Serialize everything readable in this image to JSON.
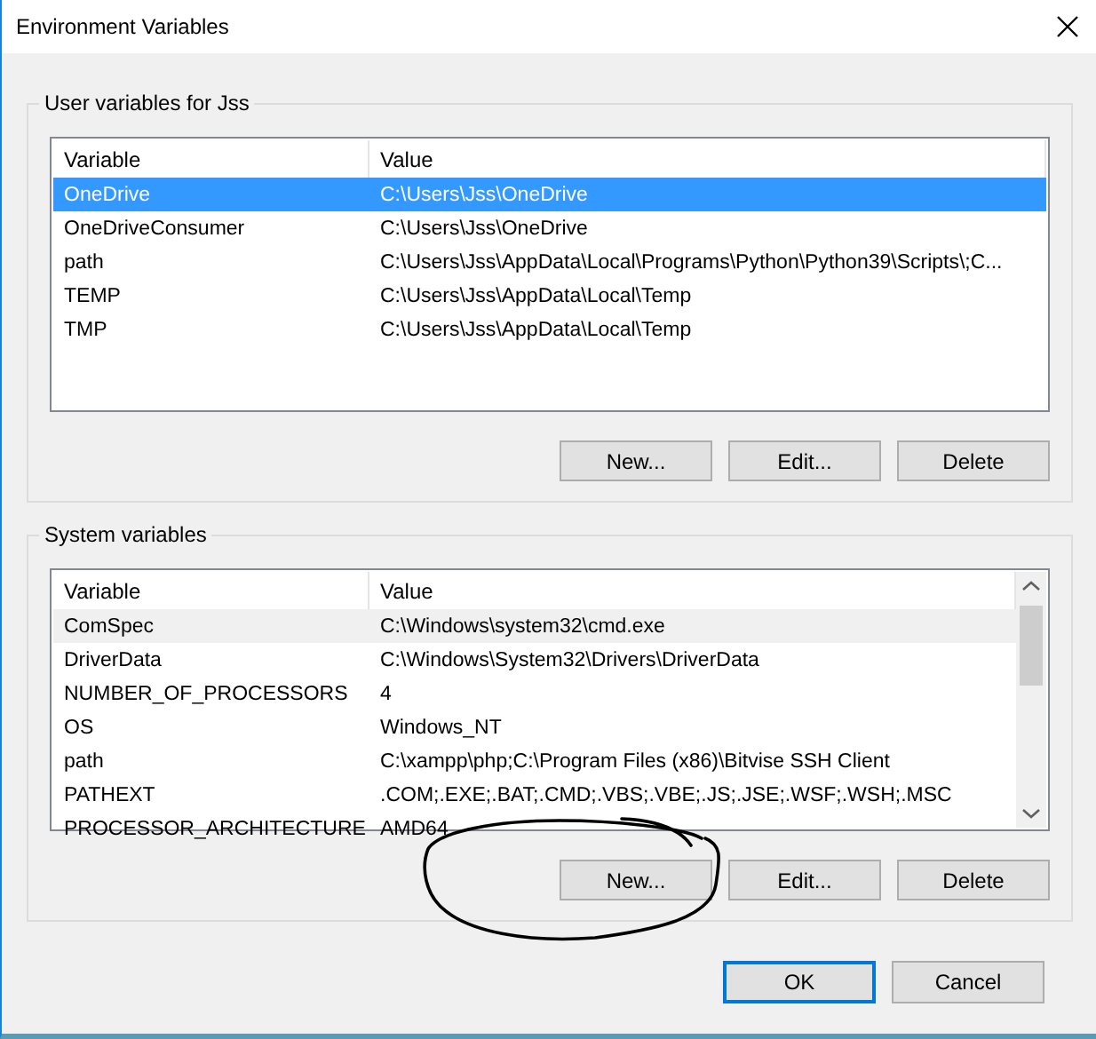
{
  "window": {
    "title": "Environment Variables"
  },
  "user_variables": {
    "title": "User variables for Jss",
    "focused": true,
    "columns": [
      "Variable",
      "Value"
    ],
    "rows": [
      {
        "variable": "OneDrive",
        "value": "C:\\Users\\Jss\\OneDrive",
        "selected": true
      },
      {
        "variable": "OneDriveConsumer",
        "value": "C:\\Users\\Jss\\OneDrive",
        "selected": false
      },
      {
        "variable": "path",
        "value": "C:\\Users\\Jss\\AppData\\Local\\Programs\\Python\\Python39\\Scripts\\;C...",
        "selected": false
      },
      {
        "variable": "TEMP",
        "value": "C:\\Users\\Jss\\AppData\\Local\\Temp",
        "selected": false
      },
      {
        "variable": "TMP",
        "value": "C:\\Users\\Jss\\AppData\\Local\\Temp",
        "selected": false
      }
    ],
    "buttons": [
      "New...",
      "Edit...",
      "Delete"
    ]
  },
  "system_variables": {
    "title": "System variables",
    "focused": false,
    "columns": [
      "Variable",
      "Value"
    ],
    "rows": [
      {
        "variable": "ComSpec",
        "value": "C:\\Windows\\system32\\cmd.exe",
        "selected": true
      },
      {
        "variable": "DriverData",
        "value": "C:\\Windows\\System32\\Drivers\\DriverData",
        "selected": false
      },
      {
        "variable": "NUMBER_OF_PROCESSORS",
        "value": "4",
        "selected": false
      },
      {
        "variable": "OS",
        "value": "Windows_NT",
        "selected": false
      },
      {
        "variable": "path",
        "value": "C:\\xampp\\php;C:\\Program Files (x86)\\Bitvise SSH Client",
        "selected": false
      },
      {
        "variable": "PATHEXT",
        "value": ".COM;.EXE;.BAT;.CMD;.VBS;.VBE;.JS;.JSE;.WSF;.WSH;.MSC",
        "selected": false
      },
      {
        "variable": "PROCESSOR_ARCHITECTURE",
        "value": "AMD64",
        "selected": false
      }
    ],
    "buttons": [
      "New...",
      "Edit...",
      "Delete"
    ]
  },
  "dialog_buttons": [
    {
      "label": "OK",
      "default": true
    },
    {
      "label": "Cancel",
      "default": false
    }
  ]
}
